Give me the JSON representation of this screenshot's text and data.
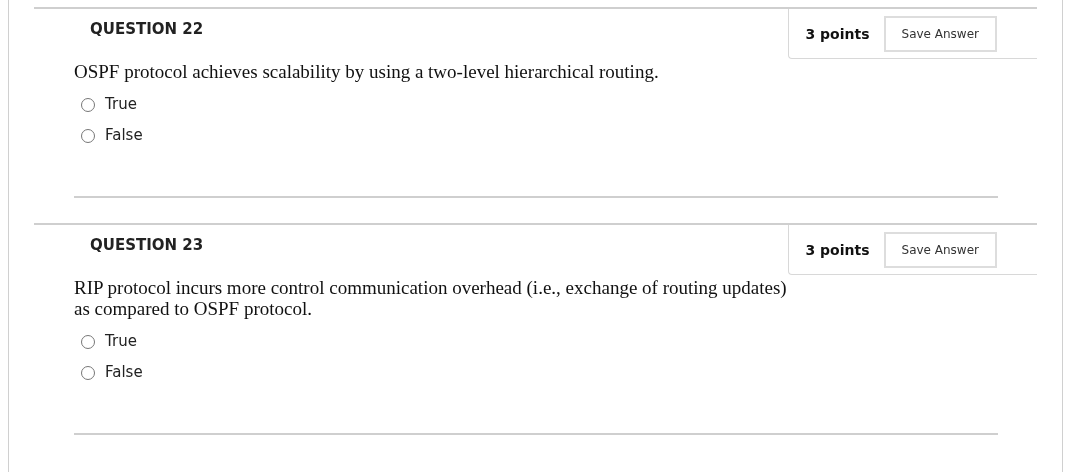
{
  "questions": [
    {
      "title": "QUESTION 22",
      "points": "3 points",
      "save_button": "Save Answer",
      "text": "OSPF protocol achieves scalability by using a two-level hierarchical routing.",
      "options": [
        {
          "label": "True",
          "selected": false
        },
        {
          "label": "False",
          "selected": false
        }
      ]
    },
    {
      "title": "QUESTION 23",
      "points": "3 points",
      "save_button": "Save Answer",
      "text": "RIP protocol incurs more control communication overhead (i.e., exchange of routing updates) as compared to OSPF protocol.",
      "options": [
        {
          "label": "True",
          "selected": false
        },
        {
          "label": "False",
          "selected": false
        }
      ]
    }
  ]
}
